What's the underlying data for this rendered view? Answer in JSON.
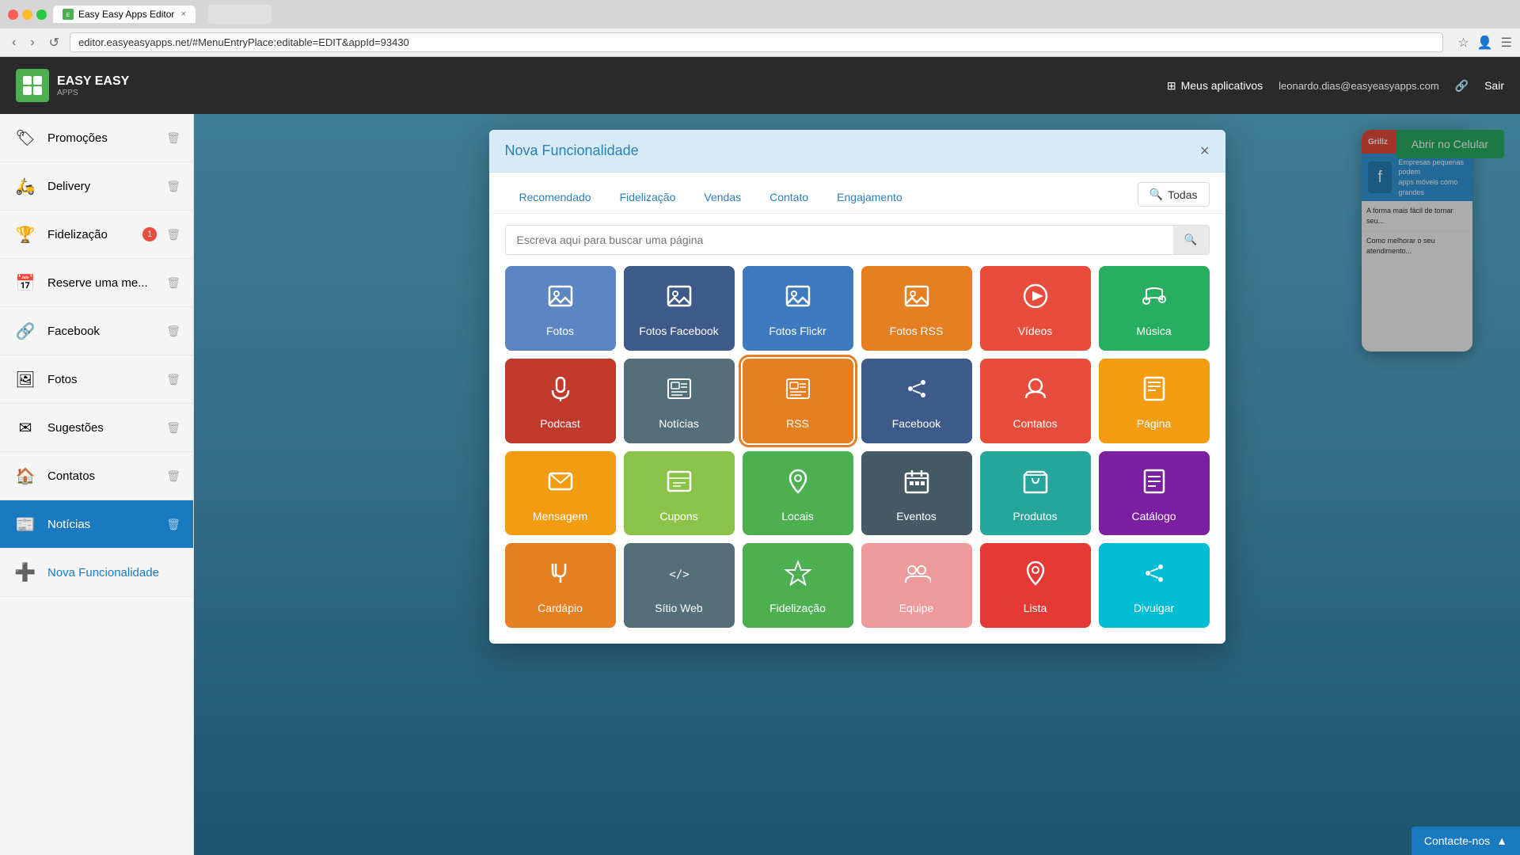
{
  "browser": {
    "tab_title": "Easy Easy Apps Editor",
    "address": "editor.easyeasyapps.net/#MenuEntryPlace:editable=EDIT&appId=93430",
    "nav_back": "‹",
    "nav_forward": "›",
    "nav_refresh": "↺"
  },
  "header": {
    "logo_name": "EASY EASY",
    "logo_sub": "APPS",
    "menu_label": "Meus aplicativos",
    "user_email": "leonardo.dias@easyeasyapps.com",
    "sair_label": "Sair"
  },
  "sidebar": {
    "items": [
      {
        "id": "promocoes",
        "label": "Promoções",
        "icon": "🏷",
        "active": false
      },
      {
        "id": "delivery",
        "label": "Delivery",
        "icon": "🛵",
        "active": false
      },
      {
        "id": "fidelizacao",
        "label": "Fidelização",
        "icon": "🏆",
        "active": false,
        "badge": "1"
      },
      {
        "id": "reserve",
        "label": "Reserve uma me...",
        "icon": "📅",
        "active": false
      },
      {
        "id": "facebook",
        "label": "Facebook",
        "icon": "🔗",
        "active": false
      },
      {
        "id": "fotos",
        "label": "Fotos",
        "icon": "🖼",
        "active": false
      },
      {
        "id": "sugestoes",
        "label": "Sugestões",
        "icon": "✉",
        "active": false
      },
      {
        "id": "contatos",
        "label": "Contatos",
        "icon": "🏠",
        "active": false
      },
      {
        "id": "noticias",
        "label": "Notícias",
        "icon": "📰",
        "active": true
      },
      {
        "id": "nova-funcionalidade",
        "label": "Nova Funcionalidade",
        "icon": "➕",
        "active": false,
        "is-add": true
      }
    ]
  },
  "modal": {
    "title": "Nova Funcionalidade",
    "close_label": "×",
    "tabs": [
      {
        "id": "recomendado",
        "label": "Recomendado"
      },
      {
        "id": "fidelizacao",
        "label": "Fidelização"
      },
      {
        "id": "vendas",
        "label": "Vendas"
      },
      {
        "id": "contato",
        "label": "Contato"
      },
      {
        "id": "engajamento",
        "label": "Engajamento"
      }
    ],
    "all_tab_label": "Todas",
    "search_placeholder": "Escreva aqui para buscar uma página",
    "grid_items": [
      {
        "id": "fotos",
        "label": "Fotos",
        "icon": "🖼",
        "color": "bg-blue-light"
      },
      {
        "id": "fotos-facebook",
        "label": "Fotos Facebook",
        "icon": "🖼",
        "color": "bg-blue-medium"
      },
      {
        "id": "fotos-flickr",
        "label": "Fotos Flickr",
        "icon": "🖼",
        "color": "bg-blue-dark",
        "selected": false
      },
      {
        "id": "fotos-rss",
        "label": "Fotos RSS",
        "icon": "🖼",
        "color": "bg-orange"
      },
      {
        "id": "videos",
        "label": "Vídeos",
        "icon": "▶",
        "color": "bg-red"
      },
      {
        "id": "musica",
        "label": "Música",
        "icon": "🎧",
        "color": "bg-green"
      },
      {
        "id": "podcast",
        "label": "Podcast",
        "icon": "🎙",
        "color": "bg-red"
      },
      {
        "id": "noticias",
        "label": "Notícias",
        "icon": "📰",
        "color": "bg-gray-blue"
      },
      {
        "id": "rss",
        "label": "RSS",
        "icon": "📰",
        "color": "bg-orange-rss",
        "selected": true
      },
      {
        "id": "facebook-share",
        "label": "Facebook",
        "icon": "🔗",
        "color": "bg-blue-medium"
      },
      {
        "id": "contatos",
        "label": "Contatos",
        "icon": "🏠",
        "color": "bg-coral"
      },
      {
        "id": "pagina",
        "label": "Página",
        "icon": "📖",
        "color": "bg-amber"
      },
      {
        "id": "mensagem",
        "label": "Mensagem",
        "icon": "✉",
        "color": "bg-amber"
      },
      {
        "id": "cupons",
        "label": "Cupons",
        "icon": "📋",
        "color": "bg-yellow-green"
      },
      {
        "id": "locais",
        "label": "Locais",
        "icon": "📍",
        "color": "bg-green-loc"
      },
      {
        "id": "eventos",
        "label": "Eventos",
        "icon": "📅",
        "color": "bg-dark-gray"
      },
      {
        "id": "produtos",
        "label": "Produtos",
        "icon": "🛒",
        "color": "bg-teal"
      },
      {
        "id": "catalogo",
        "label": "Catálogo",
        "icon": "📚",
        "color": "bg-purple"
      },
      {
        "id": "cardapio",
        "label": "Cardápio",
        "icon": "🍽",
        "color": "bg-orange"
      },
      {
        "id": "sitio-web",
        "label": "Sítio Web",
        "icon": "⟨/⟩",
        "color": "bg-gray-blue"
      },
      {
        "id": "fidelizacao-grid",
        "label": "Fidelização",
        "icon": "🏅",
        "color": "bg-green"
      },
      {
        "id": "equipe",
        "label": "Equipe",
        "icon": "👥",
        "color": "bg-salmon"
      },
      {
        "id": "lista",
        "label": "Lista",
        "icon": "📍",
        "color": "bg-red"
      },
      {
        "id": "divulgar",
        "label": "Divulgar",
        "icon": "🔗",
        "color": "bg-cyan"
      }
    ]
  },
  "content": {
    "open_mobile_label": "Abrir no Celular"
  },
  "contact": {
    "label": "Contacte-nos",
    "collapse_icon": "▲"
  }
}
